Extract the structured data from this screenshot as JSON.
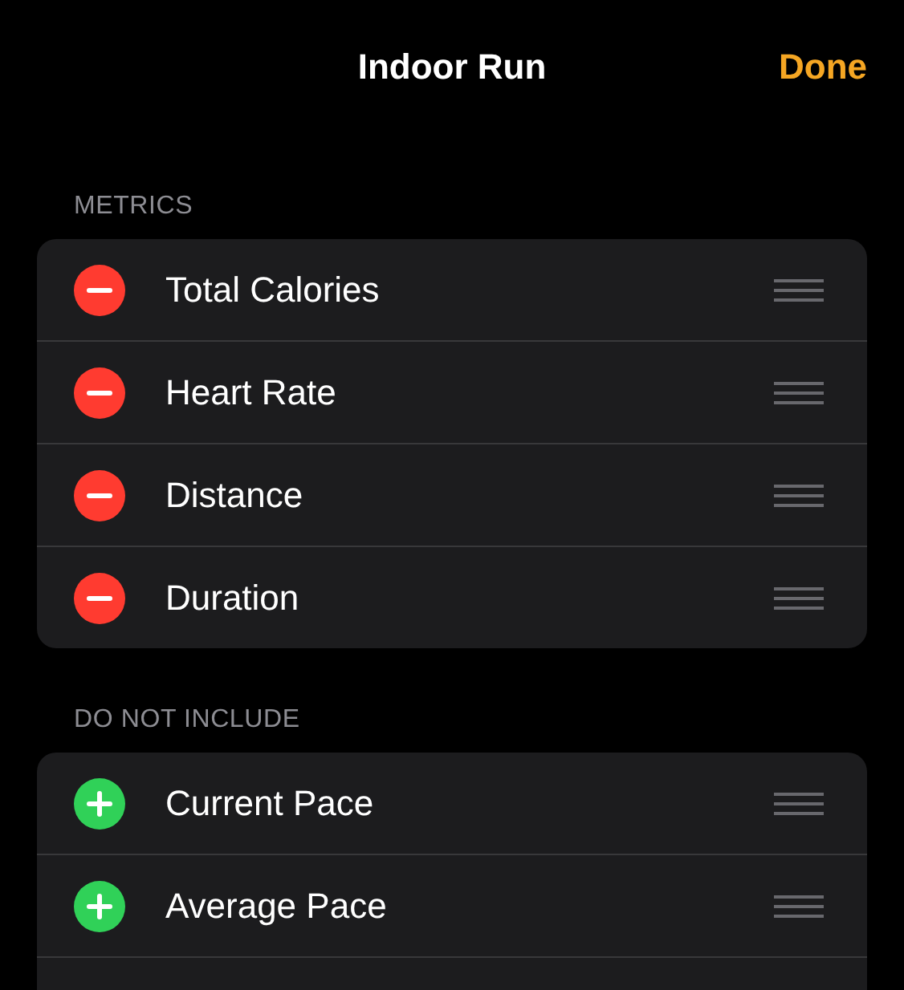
{
  "header": {
    "title": "Indoor Run",
    "done": "Done"
  },
  "sections": [
    {
      "title": "METRICS",
      "items": [
        {
          "label": "Total Calories",
          "kind": "remove"
        },
        {
          "label": "Heart Rate",
          "kind": "remove"
        },
        {
          "label": "Distance",
          "kind": "remove"
        },
        {
          "label": "Duration",
          "kind": "remove"
        }
      ]
    },
    {
      "title": "DO NOT INCLUDE",
      "items": [
        {
          "label": "Current Pace",
          "kind": "add"
        },
        {
          "label": "Average Pace",
          "kind": "add"
        }
      ]
    }
  ]
}
